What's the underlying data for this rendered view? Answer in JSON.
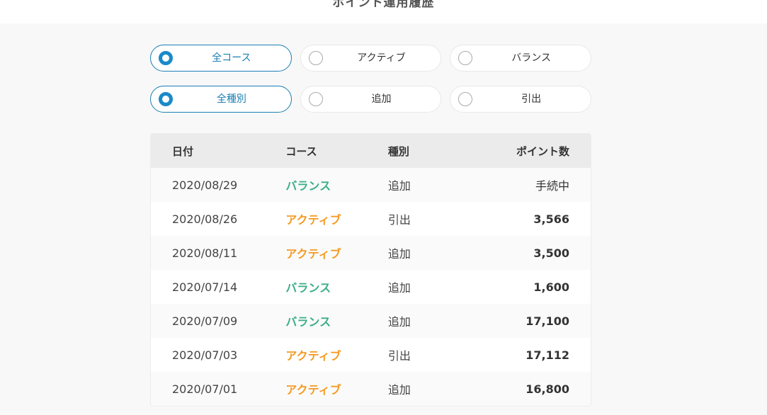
{
  "page": {
    "title": "ポイント運用履歴"
  },
  "filters": {
    "course": [
      {
        "label": "全コース",
        "selected": true
      },
      {
        "label": "アクティブ",
        "selected": false
      },
      {
        "label": "バランス",
        "selected": false
      }
    ],
    "type": [
      {
        "label": "全種別",
        "selected": true
      },
      {
        "label": "追加",
        "selected": false
      },
      {
        "label": "引出",
        "selected": false
      }
    ]
  },
  "table": {
    "headers": {
      "date": "日付",
      "course": "コース",
      "type": "種別",
      "points": "ポイント数"
    },
    "rows": [
      {
        "date": "2020/08/29",
        "course": "バランス",
        "type": "追加",
        "points": "手続中"
      },
      {
        "date": "2020/08/26",
        "course": "アクティブ",
        "type": "引出",
        "points": "3,566"
      },
      {
        "date": "2020/08/11",
        "course": "アクティブ",
        "type": "追加",
        "points": "3,500"
      },
      {
        "date": "2020/07/14",
        "course": "バランス",
        "type": "追加",
        "points": "1,600"
      },
      {
        "date": "2020/07/09",
        "course": "バランス",
        "type": "追加",
        "points": "17,100"
      },
      {
        "date": "2020/07/03",
        "course": "アクティブ",
        "type": "引出",
        "points": "17,112"
      },
      {
        "date": "2020/07/01",
        "course": "アクティブ",
        "type": "追加",
        "points": "16,800"
      }
    ]
  },
  "colors": {
    "accent": "#1a7fb2",
    "balance": "#3aaf85",
    "active": "#f59b23"
  }
}
